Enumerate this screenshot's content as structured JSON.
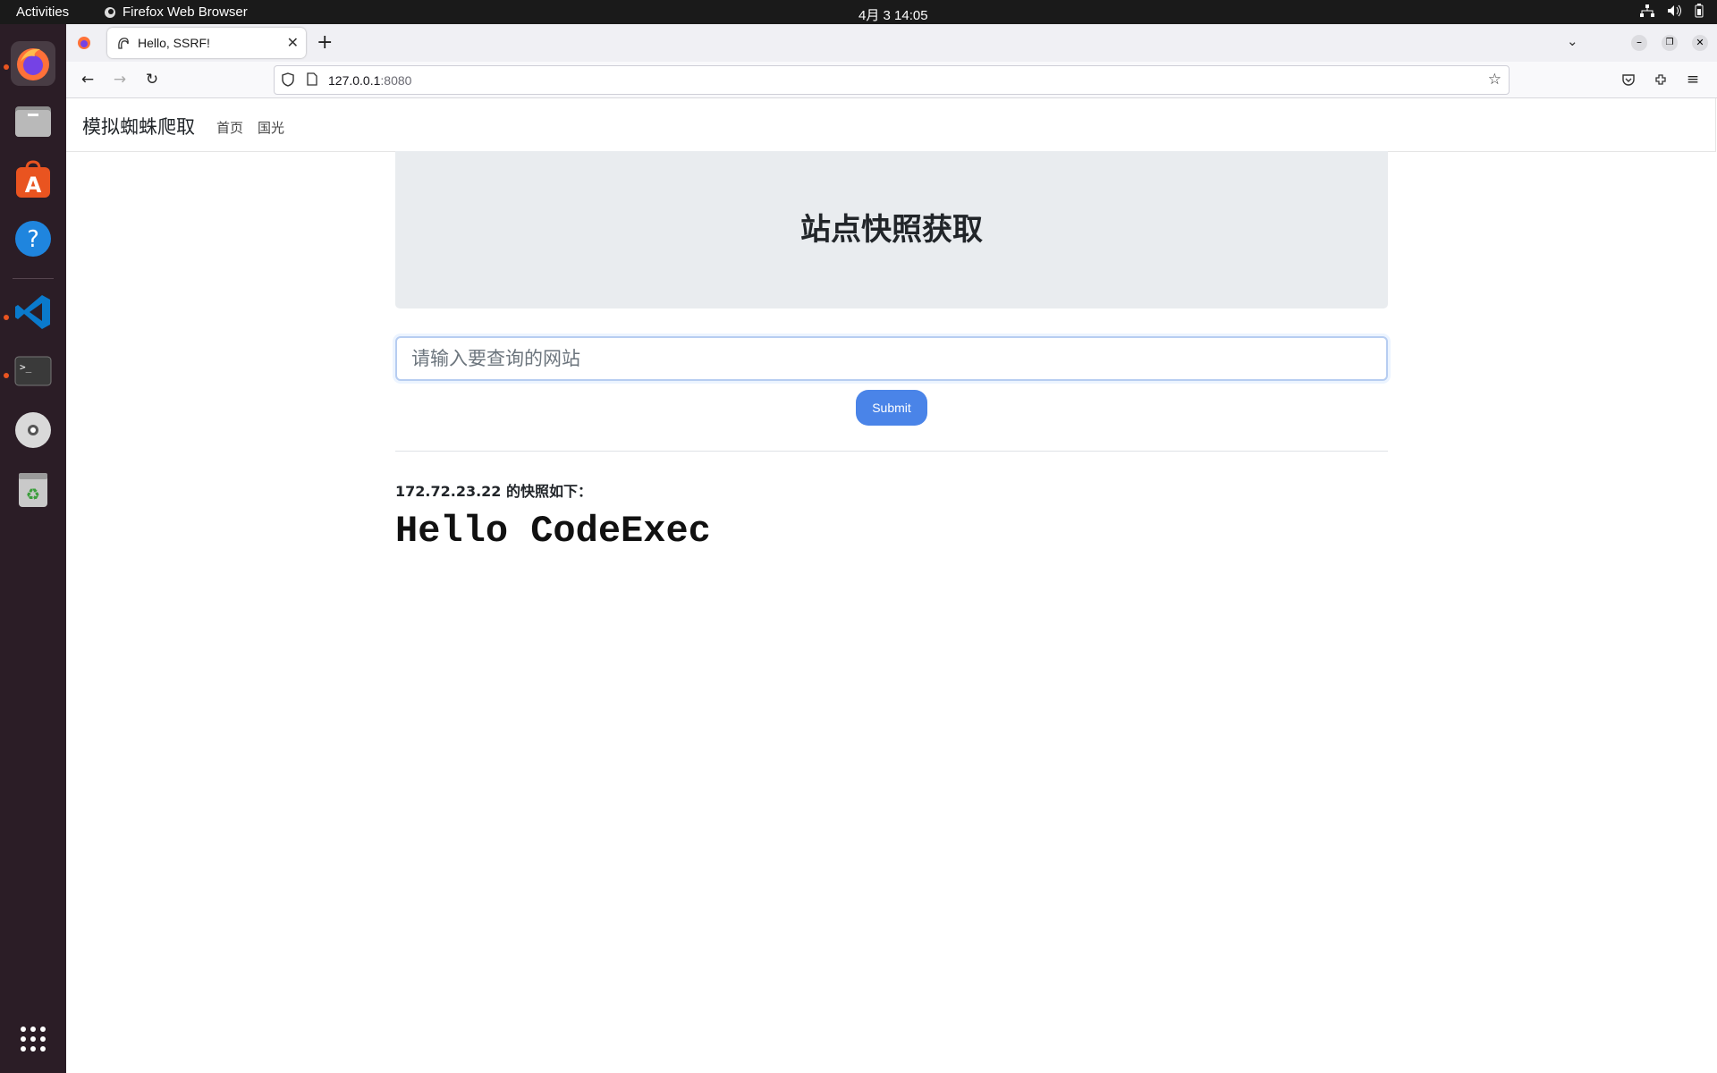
{
  "topbar": {
    "activities": "Activities",
    "app_name": "Firefox Web Browser",
    "clock": "4月 3  14:05"
  },
  "dock": {
    "items": [
      "firefox",
      "files",
      "app-center",
      "help",
      "vscode",
      "terminal",
      "disc",
      "trash",
      "show-apps"
    ]
  },
  "browser": {
    "tab_title": "Hello, SSRF!",
    "url_host": "127.0.0.1",
    "url_port": ":8080"
  },
  "site": {
    "brand": "模拟蜘蛛爬取",
    "nav": [
      "首页",
      "国光"
    ],
    "heading": "站点快照获取",
    "input_placeholder": "请输入要查询的网站",
    "submit_label": "Submit",
    "snapshot_label": "172.72.23.22 的快照如下：",
    "snapshot_content": "Hello CodeExec"
  },
  "colors": {
    "accent": "#4a84e8",
    "jumbotron": "#e9ecef",
    "dock": "#2b1d26"
  }
}
